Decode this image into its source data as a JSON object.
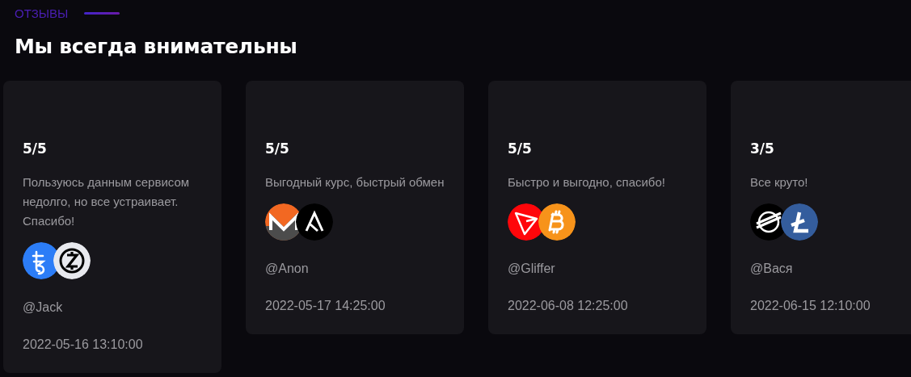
{
  "section_label": "ОТЗЫВЫ",
  "heading": "Мы всегда внимательны",
  "reviews": [
    {
      "rating": "5/5",
      "text": "Пользуюсь данным сервисом недолго, но все устраивает. Спасибо!",
      "coins": [
        {
          "kind": "tezos"
        },
        {
          "kind": "zcash"
        }
      ],
      "user": "@Jack",
      "date": "2022-05-16 13:10:00"
    },
    {
      "rating": "5/5",
      "text": "Выгодный курс, быстрый обмен",
      "coins": [
        {
          "kind": "monero"
        },
        {
          "kind": "algorand"
        }
      ],
      "user": "@Anon",
      "date": "2022-05-17 14:25:00"
    },
    {
      "rating": "5/5",
      "text": "Быстро и выгодно, спасибо!",
      "coins": [
        {
          "kind": "tron"
        },
        {
          "kind": "bitcoin"
        }
      ],
      "user": "@Gliffer",
      "date": "2022-06-08 12:25:00"
    },
    {
      "rating": "3/5",
      "text": "Все круто!",
      "coins": [
        {
          "kind": "stellar"
        },
        {
          "kind": "litecoin"
        }
      ],
      "user": "@Вася",
      "date": "2022-06-15 12:10:00"
    }
  ]
}
